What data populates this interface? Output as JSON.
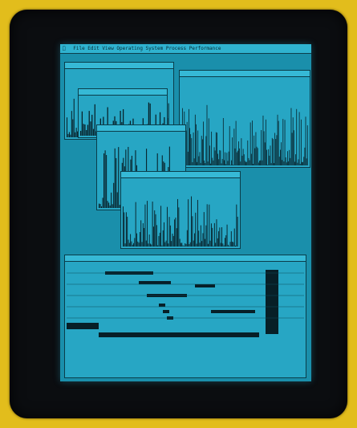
{
  "menubar": {
    "apple_icon": "apple-icon",
    "title": "File  Edit  View  Operating  System  Process  Performance"
  },
  "windows": {
    "top_left_title": "",
    "spectrum_title": "",
    "top_right_title": "",
    "center_title": "",
    "timeline_title": ""
  },
  "bottom_label": ""
}
